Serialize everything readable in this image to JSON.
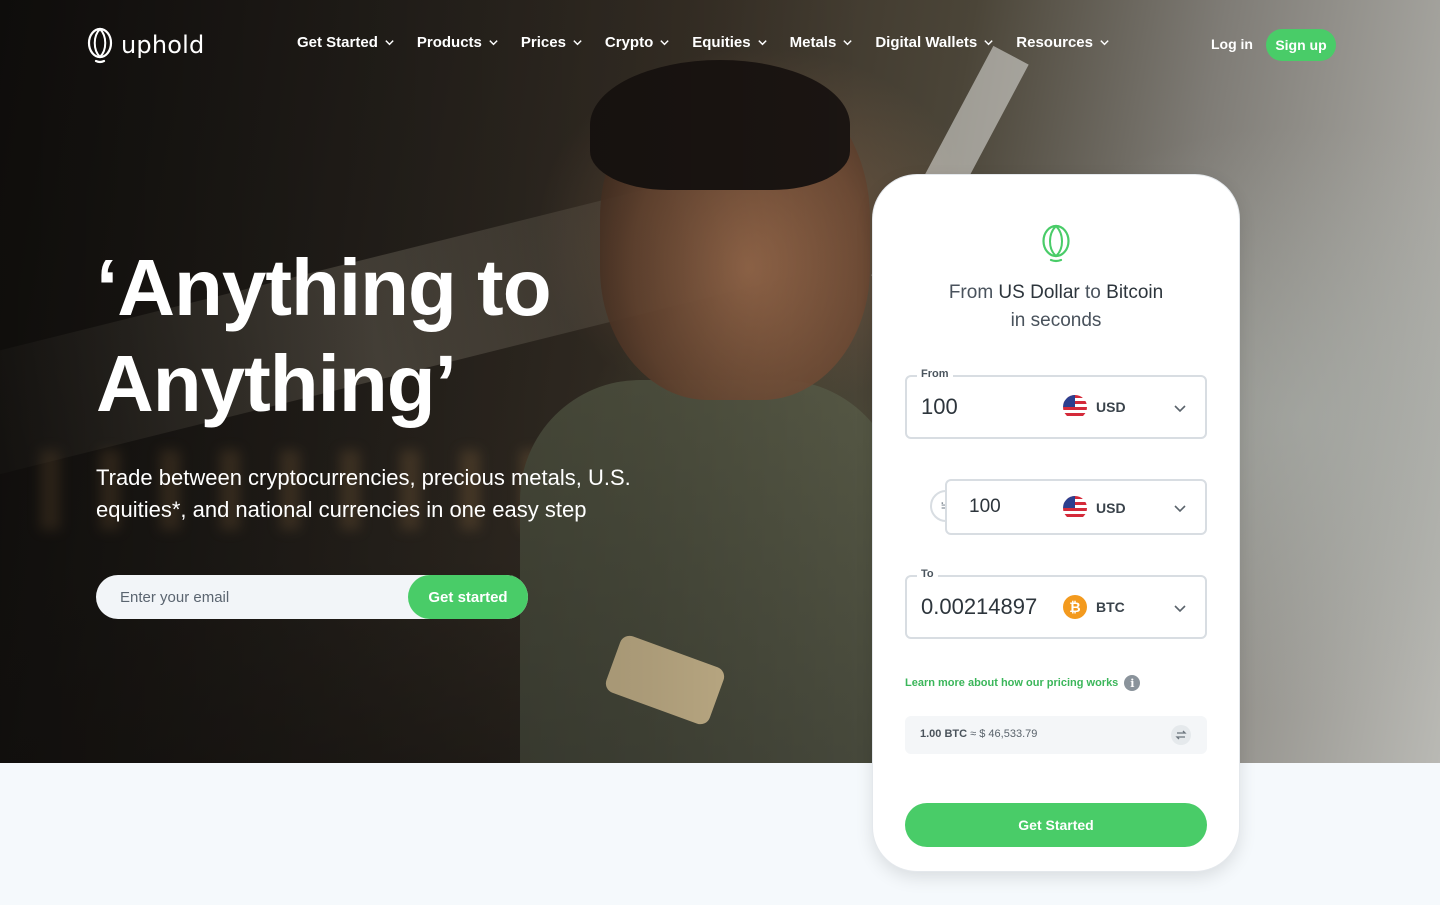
{
  "brand": {
    "name": "uphold",
    "accent": "#49cc68"
  },
  "nav": {
    "items": [
      {
        "label": "Get Started"
      },
      {
        "label": "Products"
      },
      {
        "label": "Prices"
      },
      {
        "label": "Crypto"
      },
      {
        "label": "Equities"
      },
      {
        "label": "Metals"
      },
      {
        "label": "Digital Wallets"
      },
      {
        "label": "Resources"
      }
    ],
    "login": "Log in",
    "signup": "Sign up"
  },
  "hero": {
    "headline_line1": "‘Anything to",
    "headline_line2": "Anything’",
    "subtext": "Trade between cryptocurrencies, precious metals, U.S. equities*, and national currencies in one easy step",
    "email_placeholder": "Enter your email",
    "cta": "Get started"
  },
  "widget": {
    "title_pre": "From ",
    "title_from": "US Dollar",
    "title_mid": " to ",
    "title_to": "Bitcoin",
    "title_line2": "in seconds",
    "from": {
      "label": "From",
      "value": "100",
      "currency": "USD",
      "icon": "us-flag-icon"
    },
    "mid": {
      "value": "100",
      "currency": "USD",
      "icon": "us-flag-icon"
    },
    "to": {
      "label": "To",
      "value": "0.00214897",
      "currency": "BTC",
      "icon": "bitcoin-icon"
    },
    "learn_more": "Learn more about how our pricing works",
    "rate_base": "1.00 BTC",
    "rate_approx": "≈",
    "rate_value": "$ 46,533.79",
    "cta": "Get Started"
  }
}
